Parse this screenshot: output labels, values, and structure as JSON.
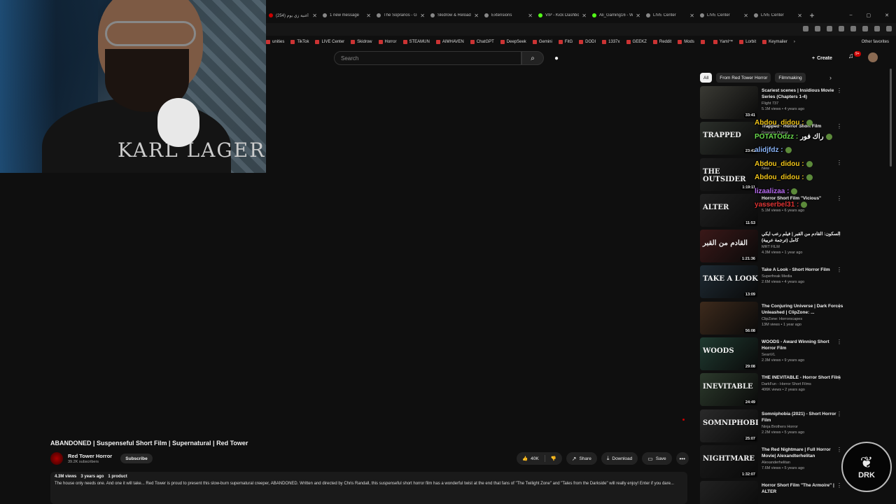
{
  "browser": {
    "tabs": [
      {
        "label": "أغنية زي يوم (254)",
        "color": "#cc0000"
      },
      {
        "label": "1 new message",
        "color": "#888888"
      },
      {
        "label": "The Sopranos - G...",
        "color": "#888888"
      },
      {
        "label": "Skidrow & Reload...",
        "color": "#888888"
      },
      {
        "label": "Extensions",
        "color": "#888888"
      },
      {
        "label": "VIP - Kick Dashbo...",
        "color": "#53fc18"
      },
      {
        "label": "Ali_Gaming16 - W...",
        "color": "#53fc18"
      },
      {
        "label": "LIVE Center",
        "color": "#888888"
      },
      {
        "label": "LIVE Center",
        "color": "#888888"
      },
      {
        "label": "LIVE Center",
        "color": "#888888"
      }
    ],
    "tab_close": "✕",
    "new_tab": "+",
    "window_controls": [
      "–",
      "▢",
      "✕"
    ],
    "bookmarks": [
      "unities",
      "TikTok",
      "LIVE Center",
      "Skidrow",
      "Horror",
      "STEAMUN",
      "AIMHAVEN",
      "ChatGPT",
      "DeepSeek",
      "Gemini",
      "FitG",
      "DODI",
      "1337x",
      "GEEKZ",
      "Reddit",
      "Mods",
      "",
      "Yaml™",
      "Lorbit",
      "Keymailer"
    ],
    "bookmarks_more": "›",
    "other_favorites": "Other favorites"
  },
  "header": {
    "search_placeholder": "Search",
    "search_icon": "⌕",
    "mic_icon": "🎙",
    "create_label": "Create",
    "create_icon": "+",
    "notifications_badge": "9+",
    "bell_icon": "🔔"
  },
  "webcam": {
    "shirt_text": "KARL LAGER"
  },
  "video": {
    "title": "ABANDONED | Suspenseful Short Film | Supernatural | Red Tower",
    "channel": "Red Tower Horror",
    "subscribers": "39.2K subscribers",
    "subscribe_label": "Subscribe",
    "likes": "40K",
    "share_label": "Share",
    "download_label": "Download",
    "save_label": "Save",
    "more_label": "•••",
    "views": "4.3M views",
    "age": "3 years ago",
    "product": "1 product",
    "description": "The house only needs one. And one it will take... Red Tower is proud to present this slow-burn supernatural creeper, ABANDONED. Written and directed by Chris Randall, this suspenseful short horror film has a wonderful twist at the end that fans of \"The Twilight Zone\" and \"Tales from the Darkside\" will really enjoy! Enter if you dare..."
  },
  "chips": [
    "All",
    "From Red Tower Horror",
    "Filmmaking"
  ],
  "chip_arrow": "›",
  "recommendations": [
    {
      "title": "Scariest scenes | Insidious Movie Series (Chapters 1-4)",
      "channel": "Flight 737",
      "meta": "5.1M views • 4 years ago",
      "duration": "33:41",
      "thumb_text": "",
      "thumb_color": "#3a3a34"
    },
    {
      "title": "Trapped - Horror Short Film",
      "channel": "Genesis Quiroz",
      "meta": "",
      "duration": "23:41",
      "thumb_text": "TRAPPED",
      "thumb_color": "#2b2f2a"
    },
    {
      "title": "",
      "channel": "Sotcha",
      "meta": "New",
      "duration": "1:19:11",
      "thumb_text": "THE OUTSIDER",
      "thumb_color": "#1c1c1c"
    },
    {
      "title": "Horror Short Film \"Vicious\"",
      "channel": "ALTER",
      "meta": "5.1M views • 6 years ago",
      "duration": "11:53",
      "thumb_text": "ALTER",
      "thumb_color": "#202020"
    },
    {
      "title": "السكون: القادم من القبر | فيلم رعب ايكي كامل (ترجمة عربية)",
      "channel": "MRT FILM",
      "meta": "4.3M views • 1 year ago",
      "duration": "1:21:36",
      "thumb_text": "القادم من القبر",
      "thumb_color": "#3a1818"
    },
    {
      "title": "Take A Look - Short Horror Film",
      "channel": "Superfreak Media",
      "meta": "2.6M views • 4 years ago",
      "duration": "13:09",
      "thumb_text": "TAKE A LOOK",
      "thumb_color": "#1e2a33"
    },
    {
      "title": "The Conjuring Universe | Dark Forces Unleashed | ClipZone: ...",
      "channel": "ClipZone: Horrorscapes",
      "meta": "13M views • 1 year ago",
      "duration": "56:08",
      "thumb_text": "",
      "thumb_color": "#3d2a1c"
    },
    {
      "title": "WOODS - Award Winning Short Horror Film",
      "channel": "SeanVL",
      "meta": "2.3M views • 9 years ago",
      "duration": "29:08",
      "thumb_text": "WOODS",
      "thumb_color": "#1f3a30"
    },
    {
      "title": "THE INEVITABLE - Horror Short Film",
      "channel": "DarkFun - Horror Short Films",
      "meta": "406K views • 2 years ago",
      "duration": "24:49",
      "thumb_text": "INEVITABLE",
      "thumb_color": "#2c3a2c"
    },
    {
      "title": "Somniphobia (2021) - Short Horror Film",
      "channel": "Ninja Brothers Horror",
      "meta": "2.2M views • 5 years ago",
      "duration": "25:07",
      "thumb_text": "SOMNIPHOBIA",
      "thumb_color": "#2a2a2a"
    },
    {
      "title": "The Red Nightmare | Full Horror Movie| Alexandterhelitan",
      "channel": "Alexanderhelitan",
      "meta": "7.6M views • 5 years ago",
      "duration": "1:32:07",
      "thumb_text": "NIGHTMARE",
      "thumb_color": "#1a1a1a"
    },
    {
      "title": "Horror Short Film \"The Armoire\" | ALTER",
      "channel": "",
      "meta": "",
      "duration": "",
      "thumb_text": "",
      "thumb_color": "#222222"
    }
  ],
  "chat": [
    {
      "user": "Abdou_didou :",
      "color": "#f0c419"
    },
    {
      "user": "POTATOdzz :",
      "color": "#6bdc4e",
      "text": "راك فور"
    },
    {
      "user": "alidjfdz :",
      "color": "#8ab4f8"
    },
    {
      "user": "Abdou_didou :",
      "color": "#f0c419"
    },
    {
      "user": "Abdou_didou :",
      "color": "#f0c419"
    },
    {
      "user": "lizaalizaa :",
      "color": "#b76bf0"
    },
    {
      "user": "yasserbel31 :",
      "color": "#e03434"
    }
  ],
  "logo": {
    "text": "DRK"
  }
}
